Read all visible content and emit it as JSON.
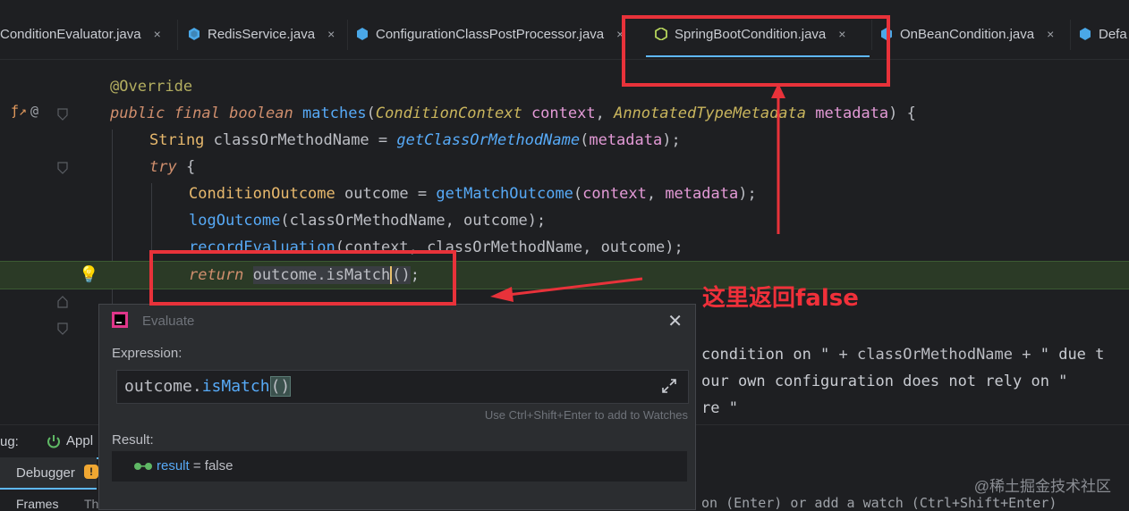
{
  "tabs": [
    {
      "label": "ConditionEvaluator.java",
      "icon": "java-class-icon",
      "active": false
    },
    {
      "label": "RedisService.java",
      "icon": "java-class-icon",
      "active": false
    },
    {
      "label": "ConfigurationClassPostProcessor.java",
      "icon": "java-class-icon",
      "active": false
    },
    {
      "label": "SpringBootCondition.java",
      "icon": "java-abstract-class-icon",
      "active": true
    },
    {
      "label": "OnBeanCondition.java",
      "icon": "java-class-icon",
      "active": false
    },
    {
      "label": "Defa",
      "icon": "java-class-icon",
      "active": false
    }
  ],
  "tab_close_glyph": "×",
  "code": {
    "line1": {
      "ann": "@Override"
    },
    "line2": {
      "kw1": "public",
      "kw2": "final",
      "kw3": "boolean",
      "fn": "matches",
      "open": "(",
      "t1": "ConditionContext",
      "p1": "context",
      "comma": ", ",
      "t2": "AnnotatedTypeMetadata",
      "p2": "metadata",
      "close": ") {"
    },
    "line3": {
      "type": "String",
      "var": "classOrMethodName",
      "eq": " = ",
      "fn": "getClassOrMethodName",
      "open": "(",
      "arg": "metadata",
      "close": ");"
    },
    "line4": {
      "kw": "try",
      "rest": " {"
    },
    "line5": {
      "type": "ConditionOutcome",
      "var": "outcome",
      "eq": " = ",
      "fn": "getMatchOutcome",
      "open": "(",
      "a1": "context",
      "comma": ", ",
      "a2": "metadata",
      "close": ");"
    },
    "line6": {
      "fn": "logOutcome",
      "args": "(classOrMethodName, outcome);"
    },
    "line7": {
      "fn": "recordEvaluation",
      "args": "(context, classOrMethodName, outcome);"
    },
    "line8": {
      "kw": "return",
      "expr": "outcome.isMatch",
      "paren_open": "(",
      "paren_close": ")",
      "end": ";"
    },
    "line9": {
      "str": "condition on \"",
      "plus": " + ",
      "var": "classOrMethodName",
      "plus2": " + ",
      "str2": "\" due t"
    },
    "line10": {
      "str": "our own configuration does not rely on \""
    },
    "line11": {
      "str": "re \""
    }
  },
  "annotation_note": "这里返回false",
  "evaluate": {
    "title": "Evaluate",
    "expression_label": "Expression:",
    "expression_obj": "outcome",
    "expression_dot": ".",
    "expression_method": "isMatch",
    "expression_parens": "()",
    "hint": "Use Ctrl+Shift+Enter to add to Watches",
    "result_label": "Result:",
    "result_name": "result",
    "result_eq": " = ",
    "result_value": "false",
    "close_glyph": "✕"
  },
  "debug_panel": {
    "debug_label": "ug:",
    "app_tab": "Appl",
    "debugger_tab": "Debugger",
    "frames_tab": "Frames",
    "threads_tab": "Th",
    "bottom_hint": "on (Enter) or add a watch (Ctrl+Shift+Enter)"
  },
  "watermark": "@稀土掘金技术社区",
  "colors": {
    "accent_red": "#e8323a",
    "active_tab_underline": "#5fb8ff",
    "exec_line_bg": "#2b3a26"
  }
}
